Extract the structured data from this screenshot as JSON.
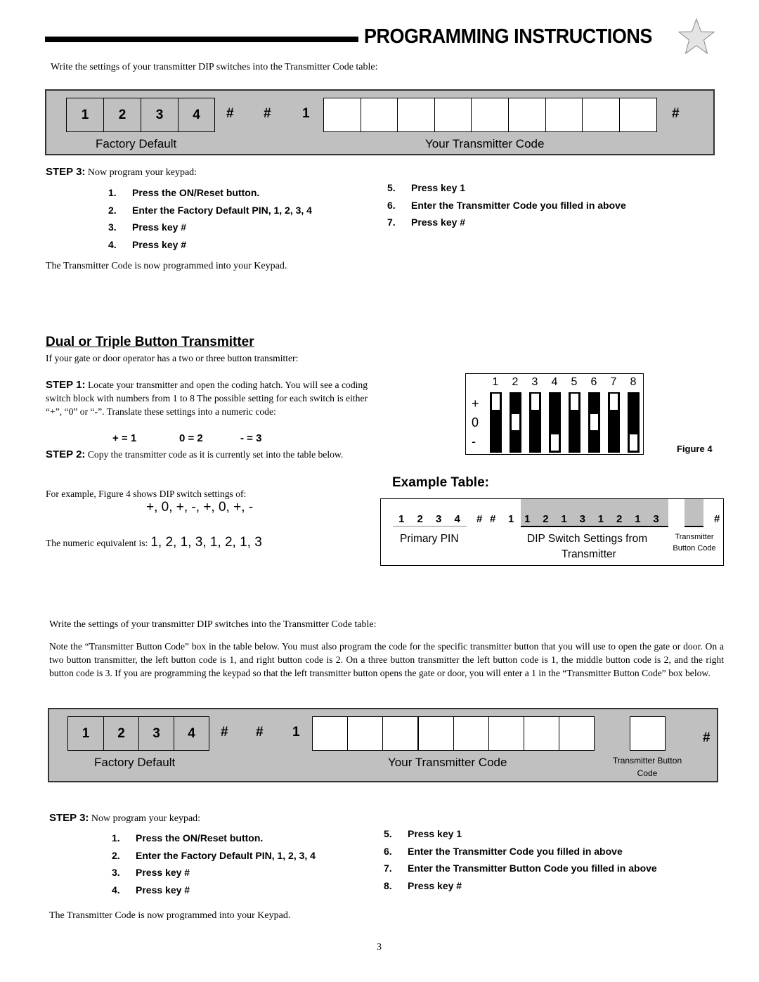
{
  "header": {
    "title": "PROGRAMMING INSTRUCTIONS",
    "icon": "star-icon"
  },
  "section1": {
    "intro": "Write the settings of your transmitter DIP switches into the Transmitter Code table:",
    "code_table": {
      "factory_digits": [
        "1",
        "2",
        "3",
        "4"
      ],
      "separators": [
        "#",
        "#",
        "1"
      ],
      "transmitter_code_boxes": [
        "",
        "",
        "",
        "",
        "",
        "",
        "",
        "",
        ""
      ],
      "end_symbol": "#",
      "factory_label": "Factory Default",
      "code_label": "Your Transmitter Code"
    },
    "step3": {
      "label": "STEP 3:",
      "text": "Now program your keypad:",
      "left_items": [
        {
          "num": "1.",
          "text": "Press the ON/Reset button."
        },
        {
          "num": "2.",
          "text": "Enter the Factory Default PIN, 1, 2, 3, 4"
        },
        {
          "num": "3.",
          "text": "Press key #"
        },
        {
          "num": "4.",
          "text": "Press key #"
        }
      ],
      "right_items": [
        {
          "num": "5.",
          "text": "Press key 1"
        },
        {
          "num": "6.",
          "text": "Enter the Transmitter Code you filled in above"
        },
        {
          "num": "7.",
          "text": "Press key #"
        }
      ],
      "footer": "The Transmitter Code is now programmed into your Keypad."
    }
  },
  "dual": {
    "heading": "Dual or Triple Button Transmitter",
    "intro": "If your gate or door operator has a two or three button transmitter:",
    "step1_label": "STEP 1:",
    "step1_text": "Locate your transmitter and open the coding hatch.  You will see a coding switch block with numbers from 1 to 8 The possible setting for each switch is either “+”, “0” or “-”.  Translate these settings into a numeric code:",
    "mapping": [
      "+ = 1",
      "0 = 2",
      "- = 3"
    ],
    "step2_label": "STEP 2:",
    "step2_text": "Copy the transmitter code as it is currently set into the table below.",
    "example_intro": "For example, Figure 4 shows DIP switch settings of:",
    "example_settings": "+, 0, +, -, +, 0, +, -",
    "numeric_prefix": "The numeric equivalent is:",
    "numeric_value": "1, 2, 1, 3, 1, 2, 1, 3"
  },
  "figure4": {
    "caption": "Figure 4",
    "switch_numbers": [
      "1",
      "2",
      "3",
      "4",
      "5",
      "6",
      "7",
      "8"
    ],
    "row_labels": [
      "+",
      "0",
      "-"
    ],
    "switch_positions": [
      "+",
      "0",
      "+",
      "-",
      "+",
      "0",
      "+",
      "-"
    ]
  },
  "example_table": {
    "title": "Example Table:",
    "pin_digits": [
      "1",
      "2",
      "3",
      "4"
    ],
    "separators": [
      "#",
      "#",
      "1"
    ],
    "dip_digits": [
      "1",
      "2",
      "1",
      "3",
      "1",
      "2",
      "1",
      "3"
    ],
    "button_code": "",
    "end_symbol": "#",
    "pin_label": "Primary PIN",
    "dip_label_line1": "DIP Switch Settings from",
    "dip_label_line2": "Transmitter",
    "button_label_line1": "Transmitter",
    "button_label_line2": "Button Code"
  },
  "section2": {
    "intro": "Write the settings of your transmitter DIP switches into the Transmitter Code table:",
    "note": "Note the “Transmitter Button Code” box in the table below.  You must also program the code for the specific transmitter button that you will use to open the gate or door.  On a two button transmitter, the left button code is 1, and right button code is 2. On a three button transmitter the left button code is 1, the middle button code is 2, and the right button code is 3.  If you are programming the keypad so that the left transmitter button opens the gate or door, you will enter a 1 in the “Transmitter Button Code” box below.",
    "code_table": {
      "factory_digits": [
        "1",
        "2",
        "3",
        "4"
      ],
      "separators": [
        "#",
        "#",
        "1"
      ],
      "transmitter_code_boxes": [
        "",
        "",
        "",
        "",
        "",
        "",
        "",
        ""
      ],
      "button_code_box": "",
      "end_symbol": "#",
      "factory_label": "Factory Default",
      "code_label": "Your Transmitter Code",
      "button_label_line1": "Transmitter Button",
      "button_label_line2": "Code"
    },
    "step3": {
      "label": "STEP 3:",
      "text": "Now program your keypad:",
      "left_items": [
        {
          "num": "1.",
          "text": "Press the ON/Reset button."
        },
        {
          "num": "2.",
          "text": "Enter the Factory Default PIN, 1, 2, 3, 4"
        },
        {
          "num": "3.",
          "text": "Press key #"
        },
        {
          "num": "4.",
          "text": "Press key #"
        }
      ],
      "right_items": [
        {
          "num": "5.",
          "text": "Press key 1"
        },
        {
          "num": "6.",
          "text": "Enter the Transmitter Code you filled in above"
        },
        {
          "num": "7.",
          "text": "Enter the Transmitter Button Code you filled in above"
        },
        {
          "num": "8.",
          "text": "Press key #"
        }
      ],
      "footer": "The Transmitter Code is now programmed into your Keypad."
    }
  },
  "page_number": "3"
}
